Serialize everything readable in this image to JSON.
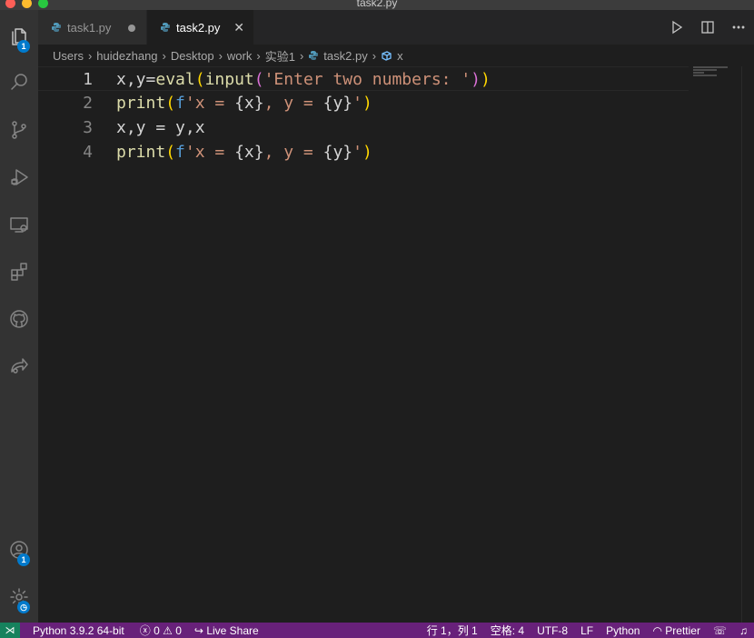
{
  "window": {
    "title": "task2.py"
  },
  "activity_bar": {
    "items": [
      {
        "icon": "files-icon",
        "badge": "1"
      },
      {
        "icon": "search-icon"
      },
      {
        "icon": "source-control-icon"
      },
      {
        "icon": "run-debug-icon"
      },
      {
        "icon": "remote-explorer-icon"
      },
      {
        "icon": "extensions-icon"
      },
      {
        "icon": "github-icon"
      },
      {
        "icon": "live-share-icon"
      }
    ],
    "bottom": [
      {
        "icon": "account-icon",
        "badge": "1"
      },
      {
        "icon": "settings-gear-icon"
      }
    ]
  },
  "tabs": [
    {
      "label": "task1.py",
      "modified": true,
      "active": false
    },
    {
      "label": "task2.py",
      "modified": false,
      "active": true
    }
  ],
  "breadcrumb": {
    "segments": [
      "Users",
      "huidezhang",
      "Desktop",
      "work",
      "实验1"
    ],
    "file": "task2.py",
    "symbol": "x"
  },
  "editor": {
    "line_numbers": [
      "1",
      "2",
      "3",
      "4"
    ],
    "current_line": 1,
    "lines": [
      [
        {
          "t": "x,y=",
          "c": "plain"
        },
        {
          "t": "eval",
          "c": "fn"
        },
        {
          "t": "(",
          "c": "paren1"
        },
        {
          "t": "input",
          "c": "fn"
        },
        {
          "t": "(",
          "c": "paren2"
        },
        {
          "t": "'Enter two numbers: '",
          "c": "str"
        },
        {
          "t": ")",
          "c": "paren2"
        },
        {
          "t": ")",
          "c": "paren1"
        }
      ],
      [
        {
          "t": "print",
          "c": "fn"
        },
        {
          "t": "(",
          "c": "paren1"
        },
        {
          "t": "f",
          "c": "kw"
        },
        {
          "t": "'x = ",
          "c": "str"
        },
        {
          "t": "{x}",
          "c": "brace"
        },
        {
          "t": ", y = ",
          "c": "str"
        },
        {
          "t": "{y}",
          "c": "brace"
        },
        {
          "t": "'",
          "c": "str"
        },
        {
          "t": ")",
          "c": "paren1"
        }
      ],
      [
        {
          "t": "x,y = y,x",
          "c": "plain"
        }
      ],
      [
        {
          "t": "print",
          "c": "fn"
        },
        {
          "t": "(",
          "c": "paren1"
        },
        {
          "t": "f",
          "c": "kw"
        },
        {
          "t": "'x = ",
          "c": "str"
        },
        {
          "t": "{x}",
          "c": "brace"
        },
        {
          "t": ", y = ",
          "c": "str"
        },
        {
          "t": "{y}",
          "c": "brace"
        },
        {
          "t": "'",
          "c": "str"
        },
        {
          "t": ")",
          "c": "paren1"
        }
      ]
    ]
  },
  "status_bar": {
    "remote_icon": "remote-icon",
    "python_env": "Python 3.9.2 64-bit",
    "errors": "0",
    "warnings": "0",
    "live_share": "Live Share",
    "position": "行 1，列 1",
    "spaces": "空格: 4",
    "encoding": "UTF-8",
    "eol": "LF",
    "language": "Python",
    "prettier": "Prettier",
    "colors": {
      "background": "#68217a",
      "remote_background": "#16825d"
    }
  }
}
